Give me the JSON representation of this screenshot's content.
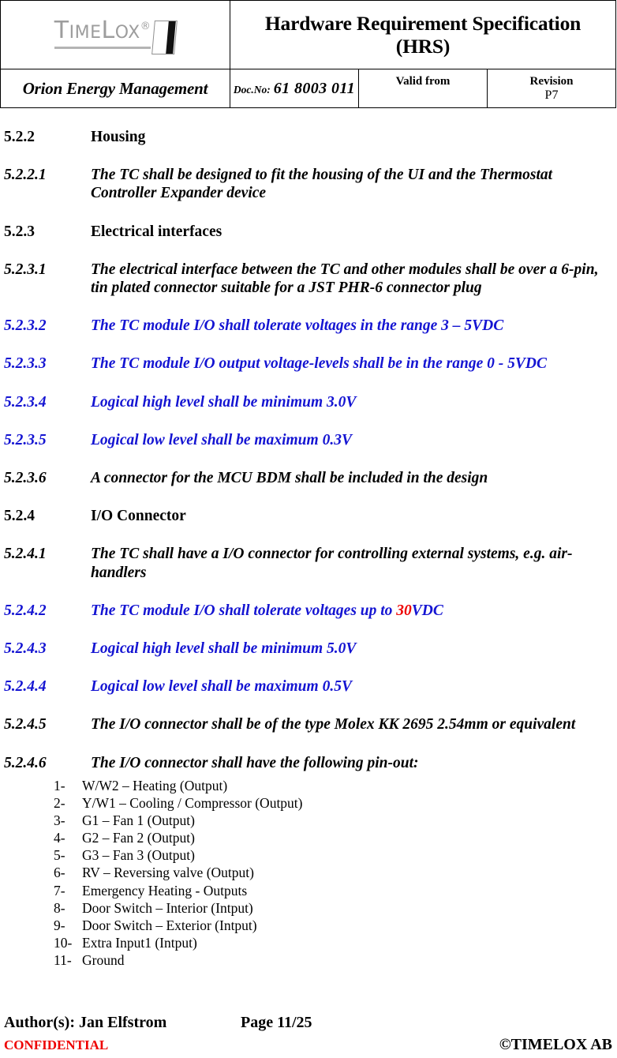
{
  "header": {
    "logo": {
      "name": "TimeLox",
      "word_main": "T",
      "word_rest": "IME",
      "word_l": "L",
      "word_ox": "OX",
      "registered": "®",
      "card_icon": "keycard-icon"
    },
    "title": "Hardware Requirement Specification (HRS)",
    "title_line1": "Hardware Requirement Specification",
    "title_line2": "(HRS)",
    "product": "Orion Energy Management",
    "docno_label": "Doc.No:",
    "docno_value": "61 8003 011",
    "validfrom_label": "Valid from",
    "validfrom_value": "",
    "revision_label": "Revision",
    "revision_value": "P7"
  },
  "colors": {
    "blue": "#1414d2",
    "red": "#ee0000",
    "logo_gray": "#9d9d9d"
  },
  "body": {
    "sections": [
      {
        "number": "5.2.2",
        "text": "Housing",
        "style": "section"
      },
      {
        "number": "5.2.2.1",
        "text": "The TC shall be designed to fit the housing of the UI and the Thermostat Controller Expander device",
        "style": "requirement"
      },
      {
        "number": "5.2.3",
        "text": "Electrical interfaces",
        "style": "section"
      },
      {
        "number": "5.2.3.1",
        "text": "The electrical interface between the TC and other modules shall be over a 6-pin, tin plated connector suitable for a JST PHR-6 connector plug",
        "style": "requirement"
      },
      {
        "number": "5.2.3.2",
        "text": "The TC module I/O shall tolerate voltages in the range 3 – 5VDC",
        "style": "requirement-blue"
      },
      {
        "number": "5.2.3.3",
        "text": "The TC module I/O output voltage-levels shall be in the range 0 - 5VDC",
        "style": "requirement-blue"
      },
      {
        "number": "5.2.3.4",
        "text": "Logical high level shall be minimum 3.0V",
        "style": "requirement-blue"
      },
      {
        "number": "5.2.3.5",
        "text": "Logical low level shall be maximum 0.3V",
        "style": "requirement-blue"
      },
      {
        "number": "5.2.3.6",
        "text": "A connector for the MCU BDM shall be included in the design",
        "style": "requirement"
      },
      {
        "number": "5.2.4",
        "text": "I/O Connector",
        "style": "section"
      },
      {
        "number": "5.2.4.1",
        "text": "The TC shall have a I/O connector for controlling external systems, e.g. air-handlers",
        "style": "requirement"
      },
      {
        "number": "5.2.4.2",
        "text_before": "The TC module I/O shall tolerate voltages up to ",
        "text_highlight": "30",
        "text_after": "VDC",
        "style": "requirement-blue-mixed"
      },
      {
        "number": "5.2.4.3",
        "text": "Logical high level shall be minimum 5.0V",
        "style": "requirement-blue"
      },
      {
        "number": "5.2.4.4",
        "text": "Logical low level shall be maximum 0.5V",
        "style": "requirement-blue"
      },
      {
        "number": "5.2.4.5",
        "text": "The I/O connector shall be of the type Molex KK 2695 2.54mm or equivalent",
        "style": "requirement"
      },
      {
        "number": "5.2.4.6",
        "text": "The I/O connector shall have the following pin-out:",
        "style": "requirement"
      }
    ],
    "pinout": [
      {
        "pin": "1-",
        "label": "W/W2 – Heating (Output)"
      },
      {
        "pin": "2-",
        "label": "Y/W1 – Cooling / Compressor (Output)"
      },
      {
        "pin": "3-",
        "label": "G1 – Fan 1 (Output)"
      },
      {
        "pin": "4-",
        "label": "G2 – Fan 2 (Output)"
      },
      {
        "pin": "5-",
        "label": "G3 – Fan 3 (Output)"
      },
      {
        "pin": "6-",
        "label": "RV – Reversing valve (Output)"
      },
      {
        "pin": "7-",
        "label": "Emergency Heating - Outputs"
      },
      {
        "pin": "8-",
        "label": "Door Switch – Interior (Intput)"
      },
      {
        "pin": "9-",
        "label": "Door Switch – Exterior (Intput)"
      },
      {
        "pin": "10-",
        "label": "Extra Input1 (Intput)"
      },
      {
        "pin": "11-",
        "label": "Ground"
      }
    ]
  },
  "footer": {
    "author": "Author(s): Jan Elfstrom",
    "page": "Page 11/25",
    "confidential": "CONFIDENTIAL",
    "copyright": "©TIMELOX AB"
  }
}
